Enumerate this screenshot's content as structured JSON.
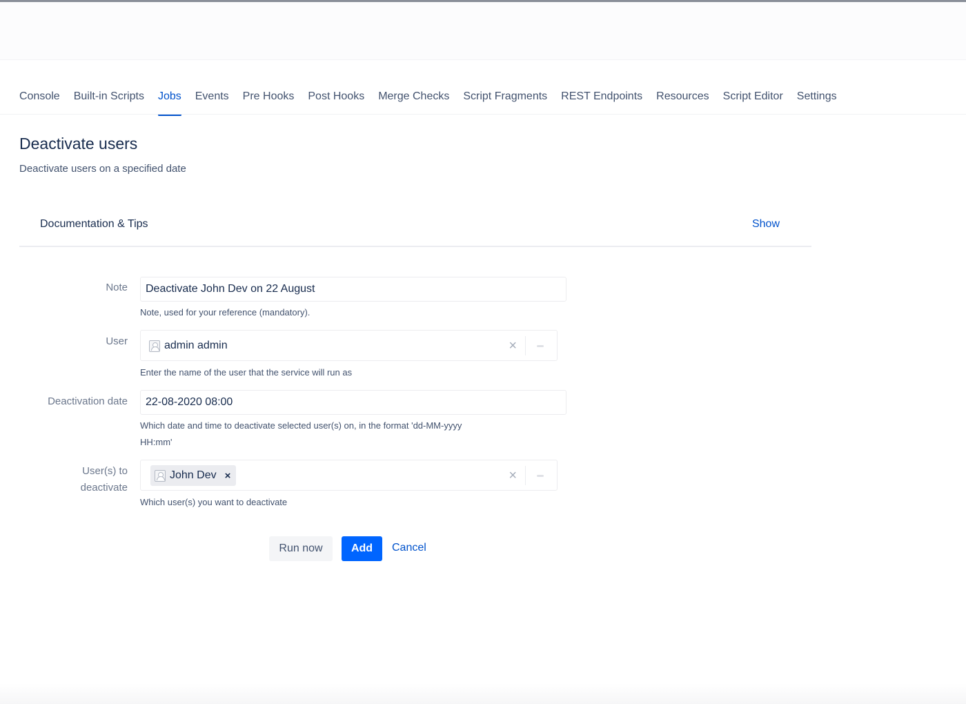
{
  "tabs": [
    {
      "label": "Console"
    },
    {
      "label": "Built-in Scripts"
    },
    {
      "label": "Jobs",
      "active": true
    },
    {
      "label": "Events"
    },
    {
      "label": "Pre Hooks"
    },
    {
      "label": "Post Hooks"
    },
    {
      "label": "Merge Checks"
    },
    {
      "label": "Script Fragments"
    },
    {
      "label": "REST Endpoints"
    },
    {
      "label": "Resources"
    },
    {
      "label": "Script Editor"
    },
    {
      "label": "Settings"
    }
  ],
  "page": {
    "title": "Deactivate users",
    "description": "Deactivate users on a specified date"
  },
  "docs": {
    "title": "Documentation & Tips",
    "show_label": "Show"
  },
  "form": {
    "note": {
      "label": "Note",
      "value": "Deactivate John Dev on 22 August",
      "help": "Note, used for your reference (mandatory)."
    },
    "user": {
      "label": "User",
      "value": "admin admin",
      "help": "Enter the name of the user that the service will run as",
      "clear_glyph": "×"
    },
    "deactivation_date": {
      "label": "Deactivation date",
      "value": "22-08-2020 08:00",
      "help_line1": "Which date and time to deactivate selected user(s) on, in the format 'dd-MM-yyyy",
      "help_line2": "HH:mm'"
    },
    "users_to_deactivate": {
      "label_line1": "User(s) to",
      "label_line2": "deactivate",
      "selected": [
        "John Dev"
      ],
      "chip_remove_glyph": "×",
      "clear_glyph": "×",
      "help": "Which user(s) you want to deactivate"
    }
  },
  "actions": {
    "run_now": "Run now",
    "add": "Add",
    "cancel": "Cancel"
  },
  "colors": {
    "accent": "#0052cc",
    "primary_button": "#0065ff",
    "text": "#172b4d",
    "muted": "#6b778c"
  },
  "icons": {
    "user_avatar": "user-avatar-icon",
    "clear": "clear-icon",
    "dropdown": "chevron-down-icon",
    "remove_chip": "remove-icon"
  }
}
